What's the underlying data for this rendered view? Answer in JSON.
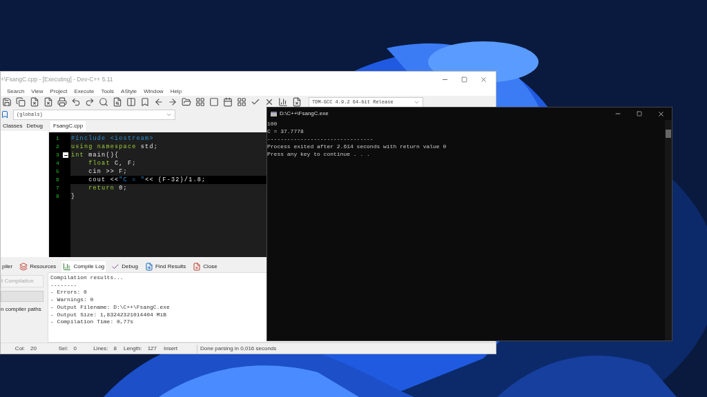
{
  "ide_window": {
    "title": "+\\FsangC.cpp - [Executing] - Dev-C++ 5.11",
    "menu": [
      "Search",
      "View",
      "Project",
      "Execute",
      "Tools",
      "AStyle",
      "Window",
      "Help"
    ],
    "scope_dropdown": {
      "value": "(globals)"
    },
    "compiler_dropdown": {
      "value": "TDM-GCC 4.9.2 64-bit Release"
    },
    "left_tabs": [
      {
        "label": "Classes",
        "selected": false
      },
      {
        "label": "Debug",
        "selected": false
      }
    ],
    "editor_tabs": [
      {
        "label": "FsangC.cpp",
        "selected": true
      }
    ],
    "code": [
      {
        "number": "1",
        "current": false,
        "tokens": [
          {
            "kind": "preprocessor",
            "text": "#include <iostream>"
          }
        ]
      },
      {
        "number": "2",
        "current": false,
        "tokens": [
          {
            "kind": "keyword",
            "text": "using namespace"
          },
          {
            "kind": "plain",
            "text": " std;"
          }
        ]
      },
      {
        "number": "3",
        "current": false,
        "tokens": [
          {
            "kind": "keyword",
            "text": "int"
          },
          {
            "kind": "plain",
            "text": " main(){"
          }
        ]
      },
      {
        "number": "4",
        "current": false,
        "tokens": [
          {
            "kind": "keyword",
            "text": "    float"
          },
          {
            "kind": "plain",
            "text": " C, F;"
          }
        ]
      },
      {
        "number": "5",
        "current": false,
        "tokens": [
          {
            "kind": "plain",
            "text": "    cin >> F;"
          }
        ]
      },
      {
        "number": "6",
        "current": true,
        "tokens": [
          {
            "kind": "plain",
            "text": "    cout <<"
          },
          {
            "kind": "string",
            "text": "\"C = \""
          },
          {
            "kind": "plain",
            "text": "<< (F-32)/1.8;"
          }
        ]
      },
      {
        "number": "7",
        "current": false,
        "tokens": [
          {
            "kind": "keyword",
            "text": "    return"
          },
          {
            "kind": "plain",
            "text": " 0;"
          }
        ]
      },
      {
        "number": "8",
        "current": false,
        "tokens": [
          {
            "kind": "plain",
            "text": "}"
          }
        ]
      }
    ],
    "bottom_tabs": [
      {
        "label": "piler",
        "selected": false
      },
      {
        "label": "Resources",
        "selected": false
      },
      {
        "label": "Compile Log",
        "selected": true
      },
      {
        "label": "Debug",
        "selected": false
      },
      {
        "label": "Find Results",
        "selected": false
      },
      {
        "label": "Close",
        "selected": false
      }
    ],
    "progress": {
      "level": 0
    },
    "abort_button": {
      "label": "t Compilation",
      "disabled": true
    },
    "compiler_paths_label": "n compiler paths",
    "compile_log": [
      "Compilation results...",
      "--------",
      "- Errors: 0",
      "- Warnings: 0",
      "- Output Filename: D:\\C++\\FsangC.exe",
      "- Output Size: 1,83242321014404 MiB",
      "- Compilation Time: 0,77s"
    ],
    "status_bar": [
      {
        "label": "Col:",
        "value": "20"
      },
      {
        "label": "Sel:",
        "value": "0"
      },
      {
        "label": "Lines:",
        "value": "8"
      },
      {
        "label": "Length:",
        "value": "127"
      },
      {
        "value": "Insert"
      },
      {
        "value": "Done parsing in 0,016 seconds"
      }
    ]
  },
  "console_window": {
    "title": "D:\\C++\\FsangC.exe",
    "lines": [
      "100",
      "C = 37.7778",
      "--------------------------------",
      "Process exited after 2.614 seconds with return value 0",
      "Press any key to continue . . ."
    ]
  }
}
